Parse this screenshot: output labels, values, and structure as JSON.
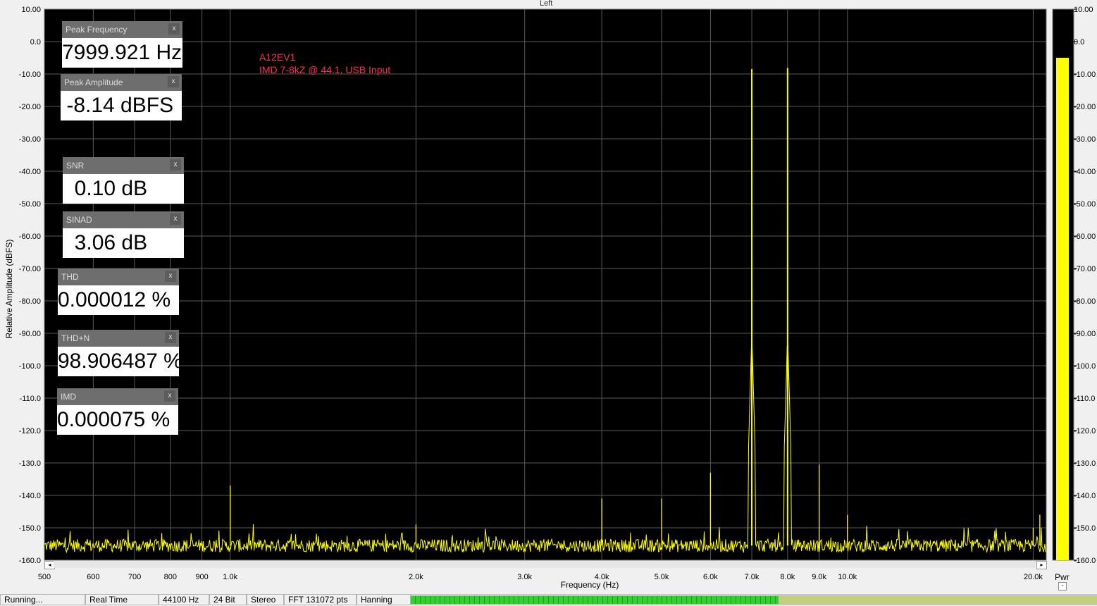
{
  "window": {
    "channel_title": "Left"
  },
  "widgets": [
    {
      "id": "peak-frequency",
      "title": "Peak Frequency",
      "value": "7999.921 Hz",
      "close": "x"
    },
    {
      "id": "peak-amplitude",
      "title": "Peak Amplitude",
      "value": " -8.14 dBFS",
      "close": "x"
    },
    {
      "id": "snr",
      "title": "SNR",
      "value": "  0.10 dB",
      "close": "x"
    },
    {
      "id": "sinad",
      "title": "SINAD",
      "value": "  3.06 dB",
      "close": "x"
    },
    {
      "id": "thd",
      "title": "THD",
      "value": "0.000012 %",
      "close": "x"
    },
    {
      "id": "thd-n",
      "title": "THD+N",
      "value": "98.906487 %",
      "close": "x"
    },
    {
      "id": "imd",
      "title": "IMD",
      "value": "0.000075 %",
      "close": "x"
    }
  ],
  "annotation": {
    "line1": "A12EV1",
    "line2": "IMD 7-8kZ @ 44.1, USB Input"
  },
  "status_bar": {
    "cells": [
      "Running...",
      "Real Time",
      "44100 Hz",
      "24 Bit",
      "Stereo",
      "FFT 131072 pts",
      "Hanning"
    ]
  },
  "level_meter": {
    "label": "Pwr",
    "level_dbfs": -5,
    "min": -160,
    "max": 10,
    "minus_label": "-"
  },
  "scrollbar": {
    "left_arrow": "◂",
    "right_arrow": "▸"
  },
  "colors": {
    "trace": "#ffff00",
    "plot_bg": "#000000",
    "grid": "#5a5a5a",
    "annotation": "#ff2d55"
  },
  "chart_data": {
    "type": "line",
    "xlabel": "Frequency (Hz)",
    "ylabel": "Relative Amplitude (dBFS)",
    "x_scale": "log",
    "xlim": [
      500,
      21000
    ],
    "ylim": [
      -160,
      10
    ],
    "x_ticks": [
      {
        "v": 500,
        "label": "500"
      },
      {
        "v": 600,
        "label": "600"
      },
      {
        "v": 700,
        "label": "700"
      },
      {
        "v": 800,
        "label": "800"
      },
      {
        "v": 900,
        "label": "900"
      },
      {
        "v": 1000,
        "label": "1.0k"
      },
      {
        "v": 2000,
        "label": "2.0k"
      },
      {
        "v": 3000,
        "label": "3.0k"
      },
      {
        "v": 4000,
        "label": "4.0k"
      },
      {
        "v": 5000,
        "label": "5.0k"
      },
      {
        "v": 6000,
        "label": "6.0k"
      },
      {
        "v": 7000,
        "label": "7.0k"
      },
      {
        "v": 8000,
        "label": "8.0k"
      },
      {
        "v": 9000,
        "label": "9.0k"
      },
      {
        "v": 10000,
        "label": "10.0k"
      },
      {
        "v": 20000,
        "label": "20.0k"
      }
    ],
    "y_ticks": [
      {
        "v": 10,
        "label": "10.00"
      },
      {
        "v": 0,
        "label": "0.0"
      },
      {
        "v": -10,
        "label": "-10.00"
      },
      {
        "v": -20,
        "label": "-20.00"
      },
      {
        "v": -30,
        "label": "-30.00"
      },
      {
        "v": -40,
        "label": "-40.00"
      },
      {
        "v": -50,
        "label": "-50.00"
      },
      {
        "v": -60,
        "label": "-60.00"
      },
      {
        "v": -70,
        "label": "-70.00"
      },
      {
        "v": -80,
        "label": "-80.00"
      },
      {
        "v": -90,
        "label": "-90.00"
      },
      {
        "v": -100,
        "label": "-100.0"
      },
      {
        "v": -110,
        "label": "-110.0"
      },
      {
        "v": -120,
        "label": "-120.0"
      },
      {
        "v": -130,
        "label": "-130.0"
      },
      {
        "v": -140,
        "label": "-140.0"
      },
      {
        "v": -150,
        "label": "-150.0"
      },
      {
        "v": -160,
        "label": "-160.0"
      }
    ],
    "noise_floor_db": -155.5,
    "peaks": [
      {
        "freq": 1000,
        "db": -137
      },
      {
        "freq": 2000,
        "db": -149
      },
      {
        "freq": 4000,
        "db": -141
      },
      {
        "freq": 5000,
        "db": -141
      },
      {
        "freq": 6000,
        "db": -133
      },
      {
        "freq": 7000,
        "db": -8.5
      },
      {
        "freq": 8000,
        "db": -8.14
      },
      {
        "freq": 9000,
        "db": -130.5
      },
      {
        "freq": 10000,
        "db": -146
      },
      {
        "freq": 20000,
        "db": -150
      },
      {
        "freq": 20500,
        "db": -146
      }
    ],
    "grid": true
  }
}
